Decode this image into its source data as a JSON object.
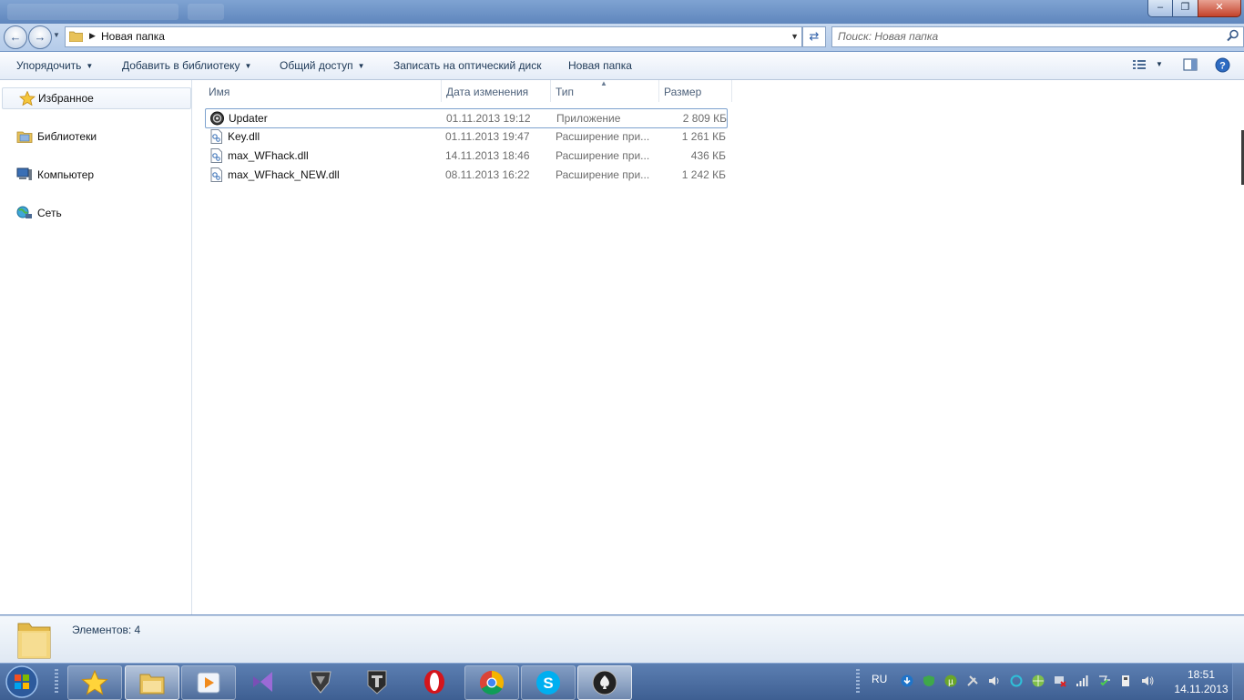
{
  "address": {
    "path": "Новая папка",
    "search_placeholder": "Поиск: Новая папка"
  },
  "toolbar": {
    "organize": "Упорядочить",
    "add_library": "Добавить в библиотеку",
    "share": "Общий доступ",
    "burn": "Записать на оптический диск",
    "new_folder": "Новая папка"
  },
  "nav": {
    "favorites": "Избранное",
    "libraries": "Библиотеки",
    "computer": "Компьютер",
    "network": "Сеть"
  },
  "columns": {
    "name": "Имя",
    "date": "Дата изменения",
    "type": "Тип",
    "size": "Размер"
  },
  "files": [
    {
      "name": "Updater",
      "date": "01.11.2013 19:12",
      "type": "Приложение",
      "size": "2 809 КБ",
      "icon": "app-icon"
    },
    {
      "name": "Key.dll",
      "date": "01.11.2013 19:47",
      "type": "Расширение при...",
      "size": "1 261 КБ",
      "icon": "dll-icon"
    },
    {
      "name": "max_WFhack.dll",
      "date": "14.11.2013 18:46",
      "type": "Расширение при...",
      "size": "436 КБ",
      "icon": "dll-icon"
    },
    {
      "name": "max_WFhack_NEW.dll",
      "date": "08.11.2013 16:22",
      "type": "Расширение при...",
      "size": "1 242 КБ",
      "icon": "dll-icon"
    }
  ],
  "status": {
    "items": "Элементов: 4"
  },
  "taskbar": {
    "lang": "RU",
    "time": "18:51",
    "date": "14.11.2013",
    "apps": [
      "star-app-icon",
      "explorer-icon",
      "media-player-icon",
      "visual-studio-icon",
      "transformers-icon",
      "world-of-tanks-icon",
      "opera-icon",
      "chrome-icon",
      "skype-icon",
      "poker-icon"
    ]
  },
  "colors": {
    "accent": "#2d5ea8",
    "taskbar": "#4a6ca0",
    "selection_border": "#7da2ce"
  }
}
